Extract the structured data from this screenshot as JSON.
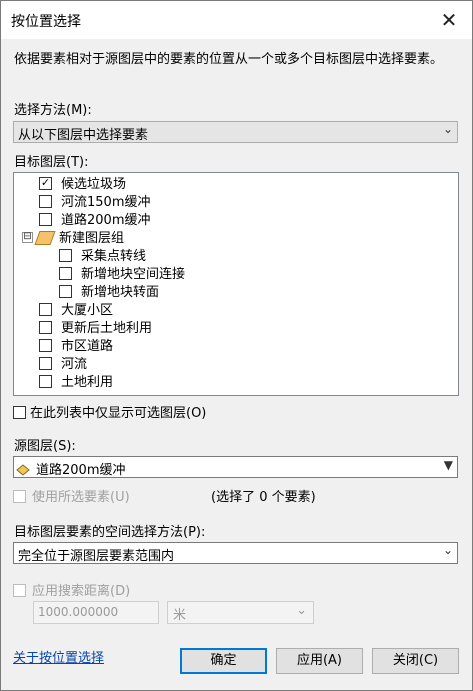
{
  "window": {
    "title": "按位置选择"
  },
  "description": "依据要素相对于源图层中的要素的位置从一个或多个目标图层中选择要素。",
  "selection_method": {
    "label": "选择方法(M):",
    "value": "从以下图层中选择要素"
  },
  "target_layers": {
    "label": "目标图层(T):",
    "items": [
      {
        "label": "候选垃圾场",
        "checked": true
      },
      {
        "label": "河流150m缓冲",
        "checked": false
      },
      {
        "label": "道路200m缓冲",
        "checked": false
      },
      {
        "label": "新建图层组",
        "group": true,
        "expander": "⊟"
      },
      {
        "label": "采集点转线",
        "checked": false
      },
      {
        "label": "新增地块空间连接",
        "checked": false
      },
      {
        "label": "新增地块转面",
        "checked": false
      },
      {
        "label": "大厦小区",
        "checked": false
      },
      {
        "label": "更新后土地利用",
        "checked": false
      },
      {
        "label": "市区道路",
        "checked": false
      },
      {
        "label": "河流",
        "checked": false
      },
      {
        "label": "土地利用",
        "checked": false
      }
    ]
  },
  "only_selectable": {
    "label": "在此列表中仅显示可选图层(O)",
    "checked": false
  },
  "source_layer": {
    "label": "源图层(S):",
    "value": "道路200m缓冲"
  },
  "use_selected": {
    "label": "使用所选要素(U)",
    "status": "(选择了 0 个要素)",
    "checked": false
  },
  "spatial_method": {
    "label": "目标图层要素的空间选择方法(P):",
    "value": "完全位于源图层要素范围内"
  },
  "search_distance": {
    "label": "应用搜索距离(D)",
    "checked": false,
    "value": "1000.000000",
    "unit": "米"
  },
  "help_link": "关于按位置选择",
  "buttons": {
    "ok": "确定",
    "apply": "应用(A)",
    "close": "关闭(C)"
  }
}
